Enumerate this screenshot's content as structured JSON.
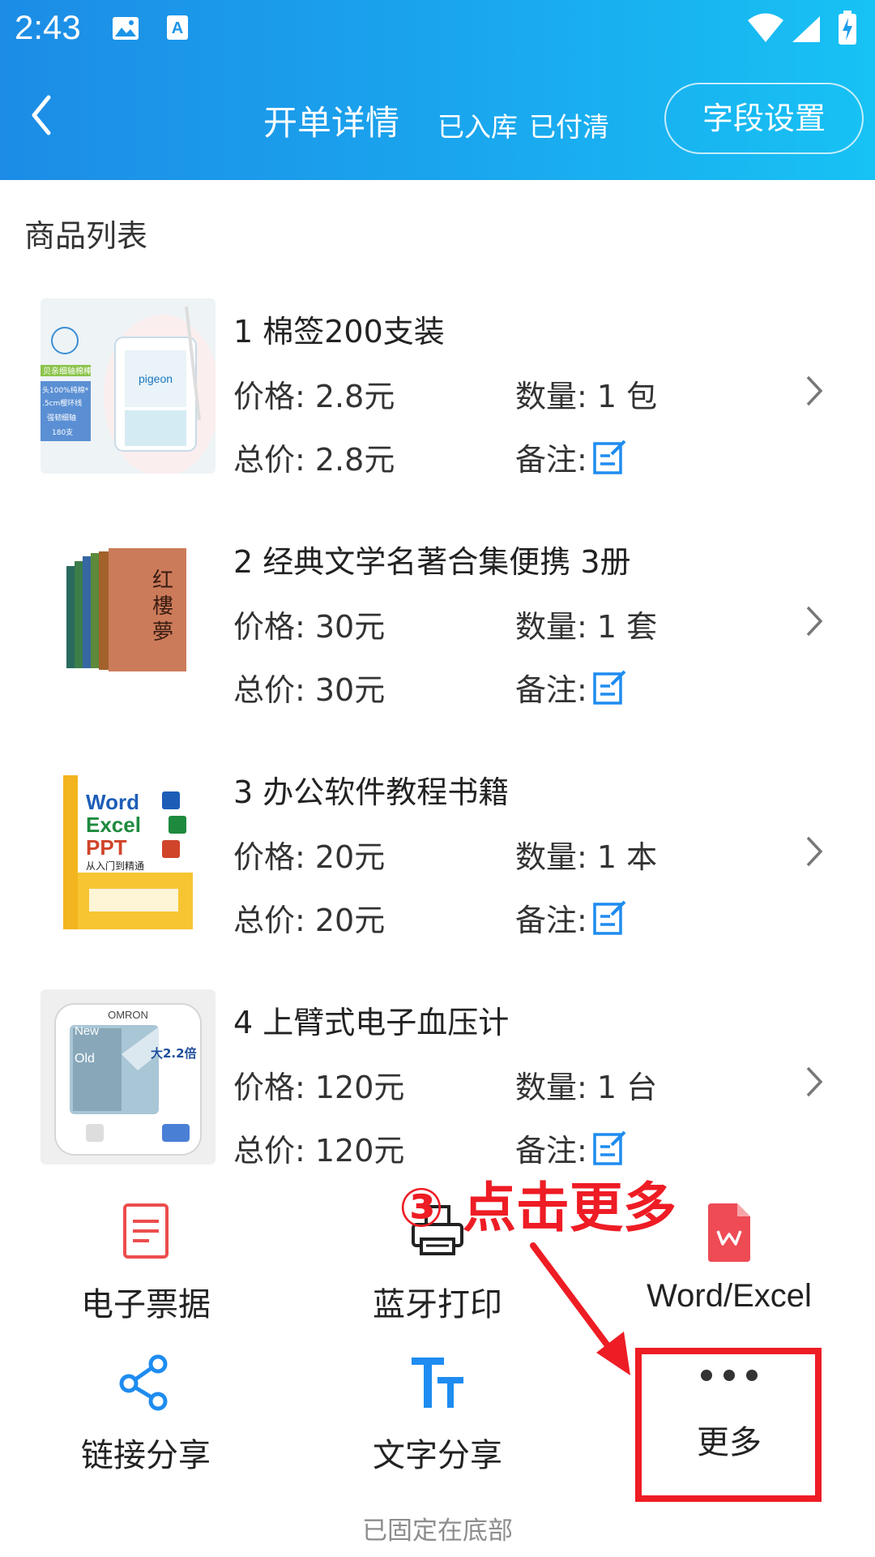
{
  "status_bar": {
    "time": "2:43"
  },
  "header": {
    "title": "开单详情",
    "states": [
      "已入库",
      "已付清"
    ],
    "field_settings_label": "字段设置"
  },
  "section": {
    "title": "商品列表"
  },
  "items": [
    {
      "name": "1 棉签200支装",
      "price": "价格: 2.8元",
      "qty": "数量: 1 包",
      "total": "总价: 2.8元",
      "note": "备注:"
    },
    {
      "name": "2 经典文学名著合集便携 3册",
      "price": "价格: 30元",
      "qty": "数量: 1 套",
      "total": "总价: 30元",
      "note": "备注:"
    },
    {
      "name": "3 办公软件教程书籍",
      "price": "价格: 20元",
      "qty": "数量: 1 本",
      "total": "总价: 20元",
      "note": "备注:"
    },
    {
      "name": "4 上臂式电子血压计",
      "price": "价格: 120元",
      "qty": "数量: 1 台",
      "total": "总价: 120元",
      "note": "备注:"
    }
  ],
  "actions": {
    "e_receipt": "电子票据",
    "bt_print": "蓝牙打印",
    "word_excel": "Word/Excel",
    "link_share": "链接分享",
    "text_share": "文字分享",
    "more": "更多"
  },
  "pinned_text": "已固定在底部",
  "annotation": "③ 点击更多",
  "product_art": {
    "cotton_swab": {
      "side_text": [
        "贝亲细轴棉棒",
        "头100%纯棉*",
        ".5cm樱环线",
        "强韧细轴",
        "180支"
      ],
      "brand": "pigeon"
    },
    "book_set": {
      "cover_title": "红楼梦"
    },
    "office_book": {
      "lines": [
        "Word",
        "Excel",
        "PPT",
        "从入门到精通"
      ]
    },
    "bp_monitor": {
      "brand": "OMRON",
      "labels": [
        "New",
        "Old",
        "大2.2倍"
      ]
    }
  },
  "colors": {
    "accent": "#1a9be8",
    "icon_blue": "#1e8cf0",
    "annotation_red": "#ee1c24"
  }
}
